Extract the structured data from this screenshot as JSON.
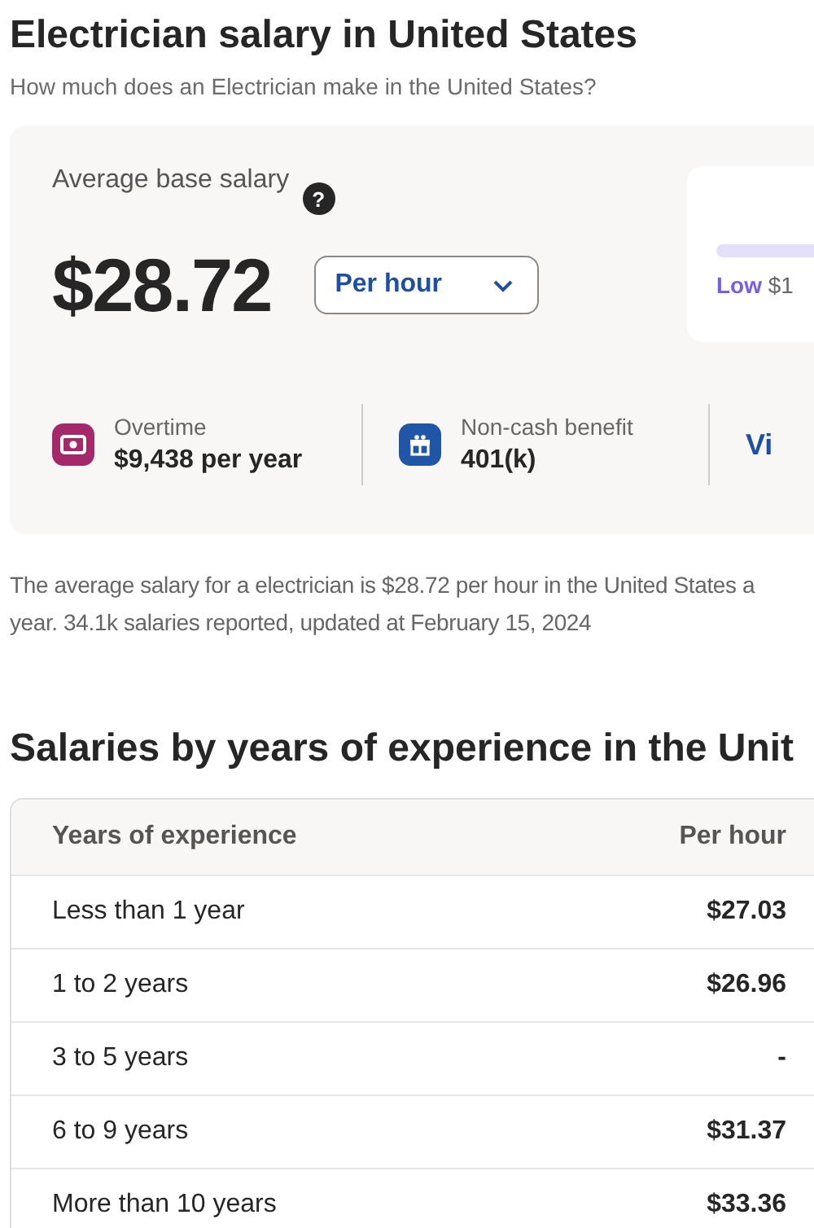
{
  "title": "Electrician salary in United States",
  "subtitle": "How much does an Electrician make in the United States?",
  "summary": {
    "label": "Average base salary",
    "help": "?",
    "amount": "$28.72",
    "period": {
      "value": "Per hour"
    },
    "range": {
      "low_label": "Low",
      "low_value": "$1"
    },
    "stats": [
      {
        "kind": "overtime",
        "label": "Overtime",
        "value": "$9,438 per year"
      },
      {
        "kind": "benefit",
        "label": "Non-cash benefit",
        "value": "401(k)"
      }
    ],
    "link": "Vi"
  },
  "description": [
    "The average salary for a electrician is $28.72 per hour in the United States a",
    "year. 34.1k salaries reported, updated at February 15, 2024"
  ],
  "experience": {
    "heading": "Salaries by years of experience in the Unit",
    "columns": [
      "Years of experience",
      "Per hour"
    ],
    "rows": [
      [
        "Less than 1 year",
        "$27.03"
      ],
      [
        "1 to 2 years",
        "$26.96"
      ],
      [
        "3 to 5 years",
        "-"
      ],
      [
        "6 to 9 years",
        "$31.37"
      ],
      [
        "More than 10 years",
        "$33.36"
      ]
    ]
  }
}
